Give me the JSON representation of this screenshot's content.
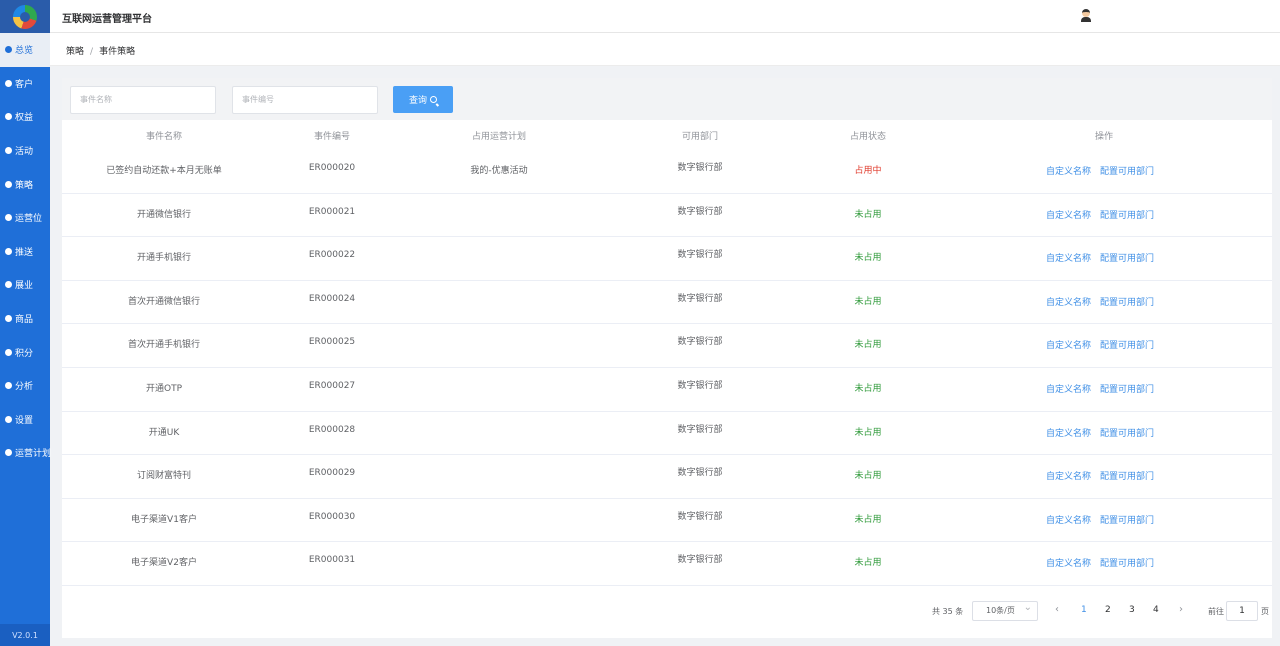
{
  "app": {
    "title": "互联网运营管理平台"
  },
  "sidebar": {
    "items": [
      {
        "label": "总览",
        "active": true
      },
      {
        "label": "客户"
      },
      {
        "label": "权益"
      },
      {
        "label": "活动"
      },
      {
        "label": "策略"
      },
      {
        "label": "运营位"
      },
      {
        "label": "推送"
      },
      {
        "label": "展业"
      },
      {
        "label": "商品"
      },
      {
        "label": "积分"
      },
      {
        "label": "分析"
      },
      {
        "label": "设置"
      },
      {
        "label": "运营计划"
      }
    ],
    "version": "V2.0.1"
  },
  "breadcrumb": {
    "parent": "策略",
    "separator": "/",
    "current": "事件策略"
  },
  "search": {
    "name_placeholder": "事件名称",
    "code_placeholder": "事件编号",
    "query_label": "查询"
  },
  "table": {
    "columns": [
      "事件名称",
      "事件编号",
      "占用运营计划",
      "可用部门",
      "占用状态",
      "操作"
    ],
    "rows": [
      {
        "name": "已签约自动还款+本月无账单",
        "code": "ER000020",
        "plan": "我的-优惠活动",
        "dept": "数字银行部",
        "status": "占用中",
        "status_type": "occupied"
      },
      {
        "name": "开通微信银行",
        "code": "ER000021",
        "plan": "",
        "dept": "数字银行部",
        "status": "未占用",
        "status_type": "free"
      },
      {
        "name": "开通手机银行",
        "code": "ER000022",
        "plan": "",
        "dept": "数字银行部",
        "status": "未占用",
        "status_type": "free"
      },
      {
        "name": "首次开通微信银行",
        "code": "ER000024",
        "plan": "",
        "dept": "数字银行部",
        "status": "未占用",
        "status_type": "free"
      },
      {
        "name": "首次开通手机银行",
        "code": "ER000025",
        "plan": "",
        "dept": "数字银行部",
        "status": "未占用",
        "status_type": "free"
      },
      {
        "name": "开通OTP",
        "code": "ER000027",
        "plan": "",
        "dept": "数字银行部",
        "status": "未占用",
        "status_type": "free"
      },
      {
        "name": "开通UK",
        "code": "ER000028",
        "plan": "",
        "dept": "数字银行部",
        "status": "未占用",
        "status_type": "free"
      },
      {
        "name": "订阅财富特刊",
        "code": "ER000029",
        "plan": "",
        "dept": "数字银行部",
        "status": "未占用",
        "status_type": "free"
      },
      {
        "name": "电子渠道V1客户",
        "code": "ER000030",
        "plan": "",
        "dept": "数字银行部",
        "status": "未占用",
        "status_type": "free"
      },
      {
        "name": "电子渠道V2客户",
        "code": "ER000031",
        "plan": "",
        "dept": "数字银行部",
        "status": "未占用",
        "status_type": "free"
      }
    ],
    "actions": [
      "自定义名称",
      "配置可用部门"
    ]
  },
  "pagination": {
    "total": "共 35 条",
    "page_size": "10条/页",
    "prev": "‹",
    "next": "›",
    "pages": [
      "1",
      "2",
      "3",
      "4"
    ],
    "current_page": "1",
    "goto_prefix": "前往",
    "goto_value": "1",
    "goto_suffix": "页"
  },
  "colors": {
    "sidebar": "#1f6fd8",
    "accent": "#4a9ff5",
    "link": "#3f8fe6",
    "occupied": "#e03b2c",
    "free": "#2f9a3a"
  }
}
